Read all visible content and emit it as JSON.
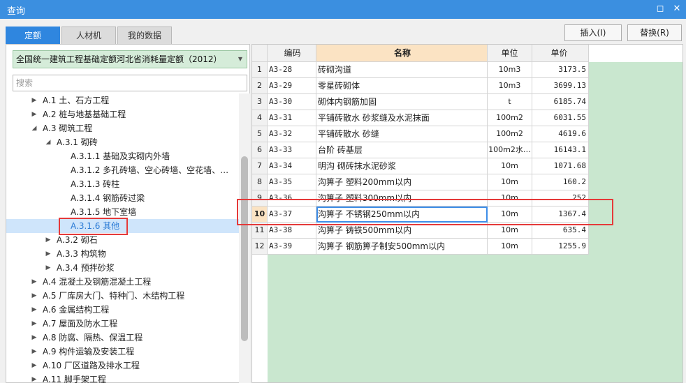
{
  "window": {
    "title": "查询",
    "restore_glyph": "◻",
    "close_glyph": "✕"
  },
  "tabs": [
    {
      "label": "定额"
    },
    {
      "label": "人材机"
    },
    {
      "label": "我的数据"
    }
  ],
  "toolbar": {
    "insert_label": "插入(I)",
    "replace_label": "替换(R)"
  },
  "left": {
    "quota_library": "全国统一建筑工程基础定额河北省消耗量定额（2012）",
    "search_placeholder": "搜索",
    "tree": [
      {
        "label": "A.1 土、石方工程",
        "arrow": "▶"
      },
      {
        "label": "A.2 桩与地基基础工程",
        "arrow": "▶"
      },
      {
        "label": "A.3 砌筑工程",
        "arrow": "◢"
      },
      {
        "label": "A.3.1 砌砖",
        "arrow": "◢"
      },
      {
        "label": "A.3.1.1 基础及实砌内外墙",
        "arrow": ""
      },
      {
        "label": "A.3.1.2 多孔砖墙、空心砖墙、空花墙、填…",
        "arrow": ""
      },
      {
        "label": "A.3.1.3 砖柱",
        "arrow": ""
      },
      {
        "label": "A.3.1.4 钢筋砖过梁",
        "arrow": ""
      },
      {
        "label": "A.3.1.5 地下室墙",
        "arrow": ""
      },
      {
        "label": "A.3.1.6 其他",
        "arrow": ""
      },
      {
        "label": "A.3.2 砌石",
        "arrow": "▶"
      },
      {
        "label": "A.3.3 构筑物",
        "arrow": "▶"
      },
      {
        "label": "A.3.4 预拌砂浆",
        "arrow": "▶"
      },
      {
        "label": "A.4 混凝土及钢筋混凝土工程",
        "arrow": "▶"
      },
      {
        "label": "A.5 厂库房大门、特种门、木结构工程",
        "arrow": "▶"
      },
      {
        "label": "A.6 金属结构工程",
        "arrow": "▶"
      },
      {
        "label": "A.7 屋面及防水工程",
        "arrow": "▶"
      },
      {
        "label": "A.8 防腐、隔热、保温工程",
        "arrow": "▶"
      },
      {
        "label": "A.9 构件运输及安装工程",
        "arrow": "▶"
      },
      {
        "label": "A.10 厂区道路及排水工程",
        "arrow": "▶"
      },
      {
        "label": "A.11 脚手架工程",
        "arrow": "▶"
      }
    ]
  },
  "grid": {
    "headers": {
      "code": "编码",
      "name": "名称",
      "unit": "单位",
      "price": "单价"
    },
    "rows": [
      {
        "idx": "1",
        "code": "A3-28",
        "name": "砖砌沟道",
        "unit": "10m3",
        "price": "3173.5"
      },
      {
        "idx": "2",
        "code": "A3-29",
        "name": "零星砖砌体",
        "unit": "10m3",
        "price": "3699.13"
      },
      {
        "idx": "3",
        "code": "A3-30",
        "name": "砌体内钢筋加固",
        "unit": "t",
        "price": "6185.74"
      },
      {
        "idx": "4",
        "code": "A3-31",
        "name": "平铺砖散水 砂浆缝及水泥抹面",
        "unit": "100m2",
        "price": "6031.55"
      },
      {
        "idx": "5",
        "code": "A3-32",
        "name": "平铺砖散水 砂缝",
        "unit": "100m2",
        "price": "4619.6"
      },
      {
        "idx": "6",
        "code": "A3-33",
        "name": "台阶 砖基层",
        "unit": "100m2水…",
        "price": "16143.1"
      },
      {
        "idx": "7",
        "code": "A3-34",
        "name": "明沟 砌砖抹水泥砂浆",
        "unit": "10m",
        "price": "1071.68"
      },
      {
        "idx": "8",
        "code": "A3-35",
        "name": "沟箅子 塑料200mm以内",
        "unit": "10m",
        "price": "160.2"
      },
      {
        "idx": "9",
        "code": "A3-36",
        "name": "沟箅子 塑料300mm以内",
        "unit": "10m",
        "price": "252"
      },
      {
        "idx": "10",
        "code": "A3-37",
        "name": "沟箅子 不锈钢250mm以内",
        "unit": "10m",
        "price": "1367.4"
      },
      {
        "idx": "11",
        "code": "A3-38",
        "name": "沟箅子 铸铁500mm以内",
        "unit": "10m",
        "price": "635.4"
      },
      {
        "idx": "12",
        "code": "A3-39",
        "name": "沟箅子 钢筋箅子制安500mm以内",
        "unit": "10m",
        "price": "1255.9"
      }
    ]
  }
}
